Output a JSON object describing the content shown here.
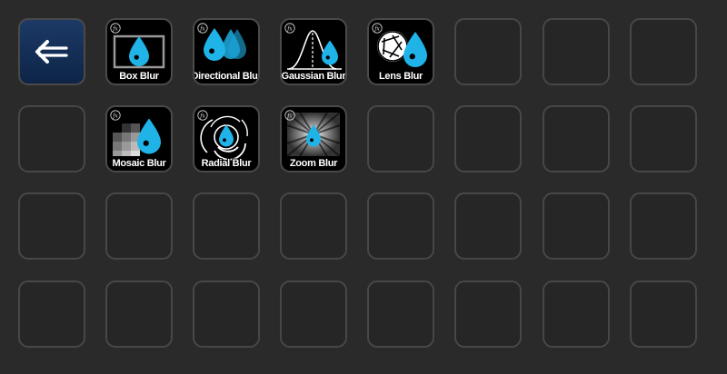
{
  "keys": {
    "back": {
      "icon": "back-arrow-icon"
    },
    "box_blur": {
      "label": "Box Blur",
      "icon": "box-blur-icon"
    },
    "directional_blur": {
      "label": "Directional Blur",
      "icon": "directional-blur-icon"
    },
    "gaussian_blur": {
      "label": "Gaussian Blur",
      "icon": "gaussian-blur-icon"
    },
    "lens_blur": {
      "label": "Lens Blur",
      "icon": "lens-blur-icon"
    },
    "mosaic_blur": {
      "label": "Mosaic Blur",
      "icon": "mosaic-blur-icon"
    },
    "radial_blur": {
      "label": "Radial Blur",
      "icon": "radial-blur-icon"
    },
    "zoom_blur": {
      "label": "Zoom Blur",
      "icon": "zoom-blur-icon"
    }
  },
  "colors": {
    "accent_drop": "#1fb3e8",
    "background": "#2a2a2a",
    "key_border": "#474747",
    "back_key": "#1c3a66"
  }
}
